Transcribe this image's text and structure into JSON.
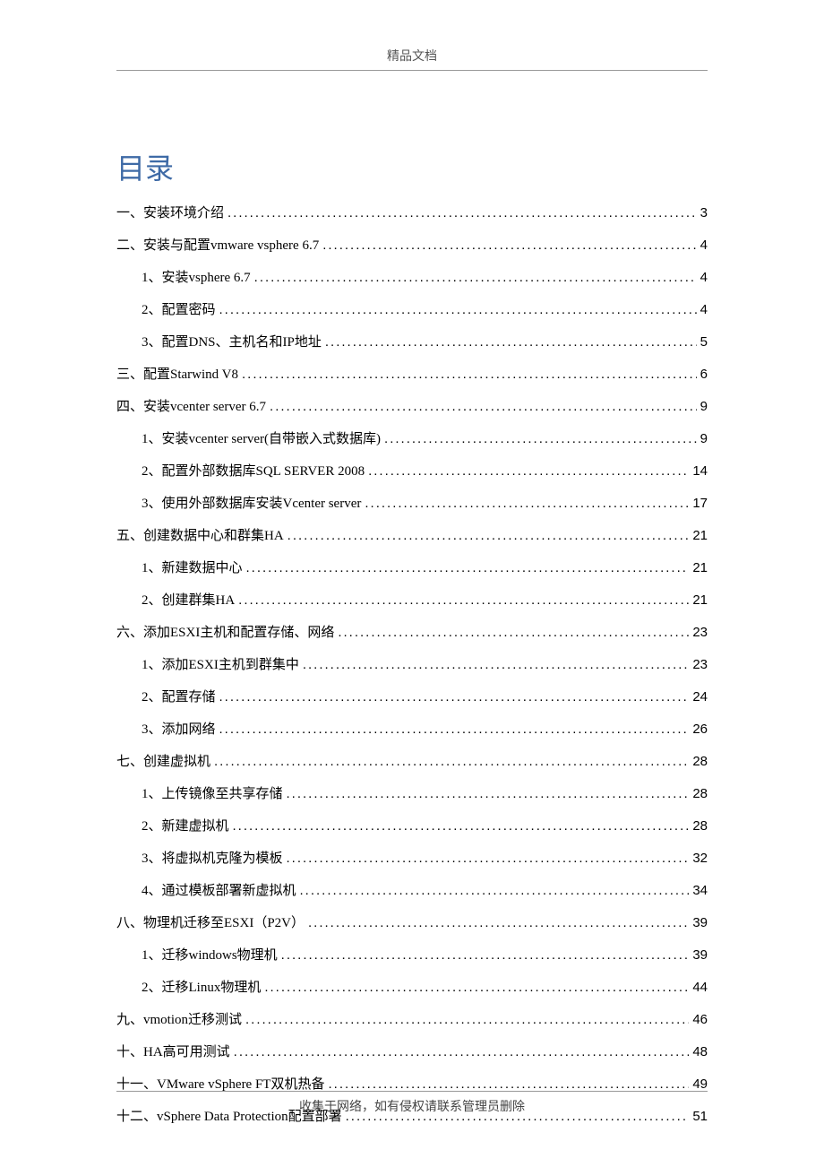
{
  "header": "精品文档",
  "title": "目录",
  "footer": "收集于网络，如有侵权请联系管理员删除",
  "toc": [
    {
      "level": 1,
      "label": "一、安装环境介绍 ",
      "page": "3"
    },
    {
      "level": 1,
      "label": "二、安装与配置vmware vsphere 6.7 ",
      "page": "4"
    },
    {
      "level": 2,
      "label": "1、安装vsphere 6.7 ",
      "page": "4"
    },
    {
      "level": 2,
      "label": "2、配置密码 ",
      "page": "4"
    },
    {
      "level": 2,
      "label": "3、配置DNS、主机名和IP地址 ",
      "page": "5"
    },
    {
      "level": 1,
      "label": "三、配置Starwind V8",
      "page": "6"
    },
    {
      "level": 1,
      "label": "四、安装vcenter server 6.7 ",
      "page": "9"
    },
    {
      "level": 2,
      "label": "1、安装vcenter server(自带嵌入式数据库) ",
      "page": "9"
    },
    {
      "level": 2,
      "label": "2、配置外部数据库SQL SERVER 2008 ",
      "page": "14"
    },
    {
      "level": 2,
      "label": "3、使用外部数据库安装Vcenter server",
      "page": "17"
    },
    {
      "level": 1,
      "label": "五、创建数据中心和群集HA",
      "page": "21"
    },
    {
      "level": 2,
      "label": "1、新建数据中心 ",
      "page": "21"
    },
    {
      "level": 2,
      "label": "2、创建群集HA ",
      "page": "21"
    },
    {
      "level": 1,
      "label": "六、添加ESXI主机和配置存储、网络",
      "page": "23"
    },
    {
      "level": 2,
      "label": "1、添加ESXI主机到群集中 ",
      "page": "23"
    },
    {
      "level": 2,
      "label": "2、配置存储 ",
      "page": "24"
    },
    {
      "level": 2,
      "label": "3、添加网络 ",
      "page": "26"
    },
    {
      "level": 1,
      "label": "七、创建虚拟机 ",
      "page": "28"
    },
    {
      "level": 2,
      "label": "1、上传镜像至共享存储 ",
      "page": "28"
    },
    {
      "level": 2,
      "label": "2、新建虚拟机 ",
      "page": "28"
    },
    {
      "level": 2,
      "label": "3、将虚拟机克隆为模板 ",
      "page": "32"
    },
    {
      "level": 2,
      "label": "4、通过模板部署新虚拟机 ",
      "page": "34"
    },
    {
      "level": 1,
      "label": "八、物理机迁移至ESXI（P2V） ",
      "page": "39"
    },
    {
      "level": 2,
      "label": "1、迁移windows物理机",
      "page": "39"
    },
    {
      "level": 2,
      "label": "2、迁移Linux物理机",
      "page": "44"
    },
    {
      "level": 1,
      "label": "九、vmotion迁移测试",
      "page": "46"
    },
    {
      "level": 1,
      "label": "十、HA高可用测试 ",
      "page": "48"
    },
    {
      "level": 1,
      "label": "十一、VMware vSphere FT双机热备",
      "page": "49"
    },
    {
      "level": 1,
      "label": "十二、vSphere Data Protection配置部署 ",
      "page": "51"
    }
  ]
}
